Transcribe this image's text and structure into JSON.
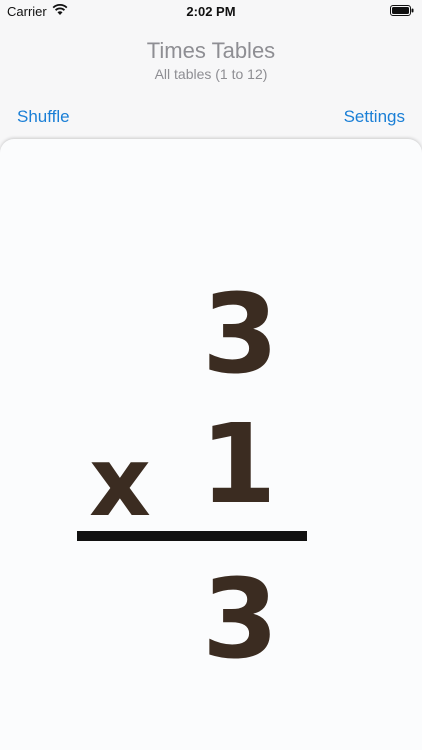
{
  "status": {
    "carrier": "Carrier",
    "time": "2:02 PM"
  },
  "header": {
    "title": "Times Tables",
    "subtitle": "All tables (1 to 12)"
  },
  "nav": {
    "left_label": "Shuffle",
    "right_label": "Settings"
  },
  "card": {
    "top_number": "3",
    "operator": "x",
    "bottom_number": "1",
    "answer": "3"
  },
  "colors": {
    "accent": "#1a7fd6",
    "digits": "#3b2c21",
    "muted": "#8e8e93"
  }
}
